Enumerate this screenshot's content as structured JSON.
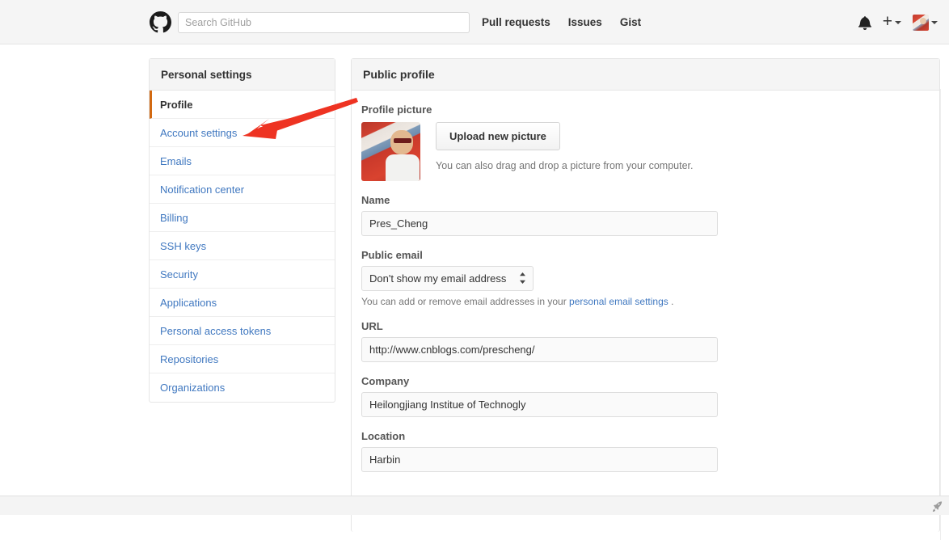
{
  "header": {
    "logo_icon": "github-mark-icon",
    "search": {
      "placeholder": "Search GitHub",
      "value": ""
    },
    "nav": [
      {
        "label": "Pull requests"
      },
      {
        "label": "Issues"
      },
      {
        "label": "Gist"
      }
    ],
    "notifications_icon": "bell-icon",
    "create_new_label": "+",
    "create_new_icon": "plus-icon",
    "dropdown_icon": "chevron-down-icon",
    "avatar_icon": "user-avatar-icon"
  },
  "sidebar": {
    "title": "Personal settings",
    "items": [
      {
        "label": "Profile",
        "active": true
      },
      {
        "label": "Account settings",
        "active": false
      },
      {
        "label": "Emails",
        "active": false
      },
      {
        "label": "Notification center",
        "active": false
      },
      {
        "label": "Billing",
        "active": false
      },
      {
        "label": "SSH keys",
        "active": false
      },
      {
        "label": "Security",
        "active": false
      },
      {
        "label": "Applications",
        "active": false
      },
      {
        "label": "Personal access tokens",
        "active": false
      },
      {
        "label": "Repositories",
        "active": false
      },
      {
        "label": "Organizations",
        "active": false
      }
    ]
  },
  "main": {
    "panel_title": "Public profile",
    "profile_picture": {
      "label": "Profile picture",
      "avatar_icon": "profile-photo-icon",
      "upload_button": "Upload new picture",
      "help_text": "You can also drag and drop a picture from your computer."
    },
    "name": {
      "label": "Name",
      "value": "Pres_Cheng"
    },
    "public_email": {
      "label": "Public email",
      "selected": "Don't show my email address",
      "options": [
        "Don't show my email address"
      ],
      "help_prefix": "You can add or remove email addresses in your ",
      "help_link": "personal email settings",
      "help_suffix": " ."
    },
    "url": {
      "label": "URL",
      "value": "http://www.cnblogs.com/prescheng/"
    },
    "company": {
      "label": "Company",
      "value": "Heilongjiang Institue of Technogly"
    },
    "location": {
      "label": "Location",
      "value": "Harbin"
    }
  },
  "annotation": {
    "arrow_color": "#ee3322",
    "arrow_target": "Account settings"
  },
  "statusbar": {
    "corner_icon": "rocket-cursor-icon"
  },
  "colors": {
    "link": "#4078c0",
    "active_marker": "#d26911",
    "header_bg": "#f5f5f5",
    "border": "#e5e5e5"
  }
}
